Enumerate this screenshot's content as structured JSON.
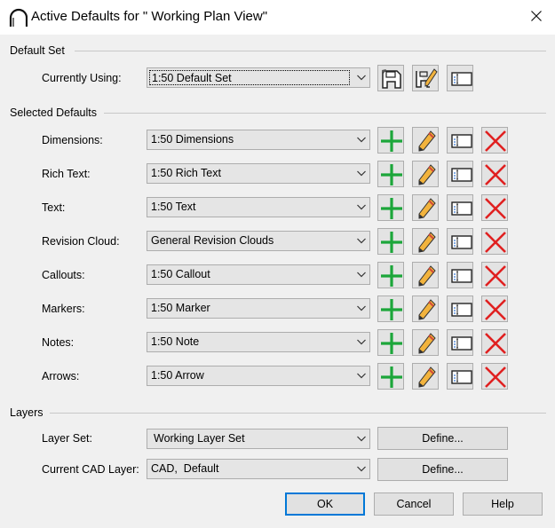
{
  "window": {
    "title": "Active Defaults for \" Working Plan View\"",
    "icon": "chief-architect-arc-icon",
    "close_icon": "close-icon"
  },
  "default_set": {
    "section_label": "Default Set",
    "currently_using_label": "Currently Using:",
    "currently_using_value": "1:50 Default Set",
    "buttons": [
      "save-set-icon",
      "edit-set-icon",
      "rename-icon"
    ]
  },
  "selected_defaults": {
    "section_label": "Selected Defaults",
    "rows": [
      {
        "label": "Dimensions:",
        "value": "1:50 Dimensions"
      },
      {
        "label": "Rich Text:",
        "value": "1:50 Rich Text"
      },
      {
        "label": "Text:",
        "value": "1:50 Text"
      },
      {
        "label": "Revision Cloud:",
        "value": "General Revision Clouds"
      },
      {
        "label": "Callouts:",
        "value": "1:50 Callout"
      },
      {
        "label": "Markers:",
        "value": "1:50 Marker"
      },
      {
        "label": "Notes:",
        "value": "1:50 Note"
      },
      {
        "label": "Arrows:",
        "value": "1:50 Arrow"
      }
    ],
    "row_buttons": [
      "add-icon",
      "edit-pencil-icon",
      "rename-icon",
      "delete-x-icon"
    ]
  },
  "layers": {
    "section_label": "Layers",
    "layer_set_label": "Layer Set:",
    "layer_set_value": "Working Layer Set",
    "current_cad_layer_label": "Current CAD Layer:",
    "current_cad_layer_value": "CAD,  Default",
    "define_label": "Define..."
  },
  "footer": {
    "ok_label": "OK",
    "cancel_label": "Cancel",
    "help_label": "Help"
  },
  "colors": {
    "dialog_bg": "#f0f0f0",
    "button_face": "#e1e1e1",
    "border": "#adadad",
    "focus_blue": "#0078d7",
    "add_green": "#1ca63a",
    "delete_red": "#e02020",
    "pencil_yellow": "#f2b33d"
  }
}
